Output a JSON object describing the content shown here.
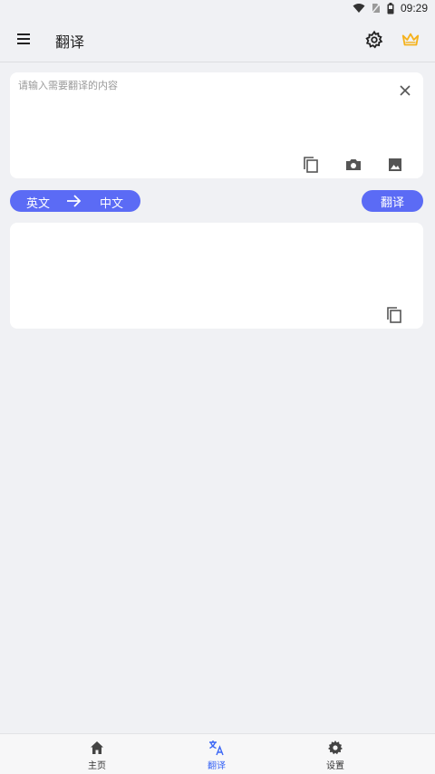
{
  "status": {
    "time": "09:29"
  },
  "header": {
    "title": "翻译"
  },
  "input": {
    "placeholder": "请输入需要翻译的内容"
  },
  "languages": {
    "source": "英文",
    "target": "中文"
  },
  "actions": {
    "translate_label": "翻译"
  },
  "nav": [
    {
      "label": "主页",
      "icon": "home-icon"
    },
    {
      "label": "翻译",
      "icon": "translate-icon",
      "active": true
    },
    {
      "label": "设置",
      "icon": "gear-icon"
    }
  ],
  "colors": {
    "accent": "#5b6bf5",
    "active_nav": "#3a66f5",
    "crown": "#f5b21c",
    "background": "#f0f1f4"
  }
}
